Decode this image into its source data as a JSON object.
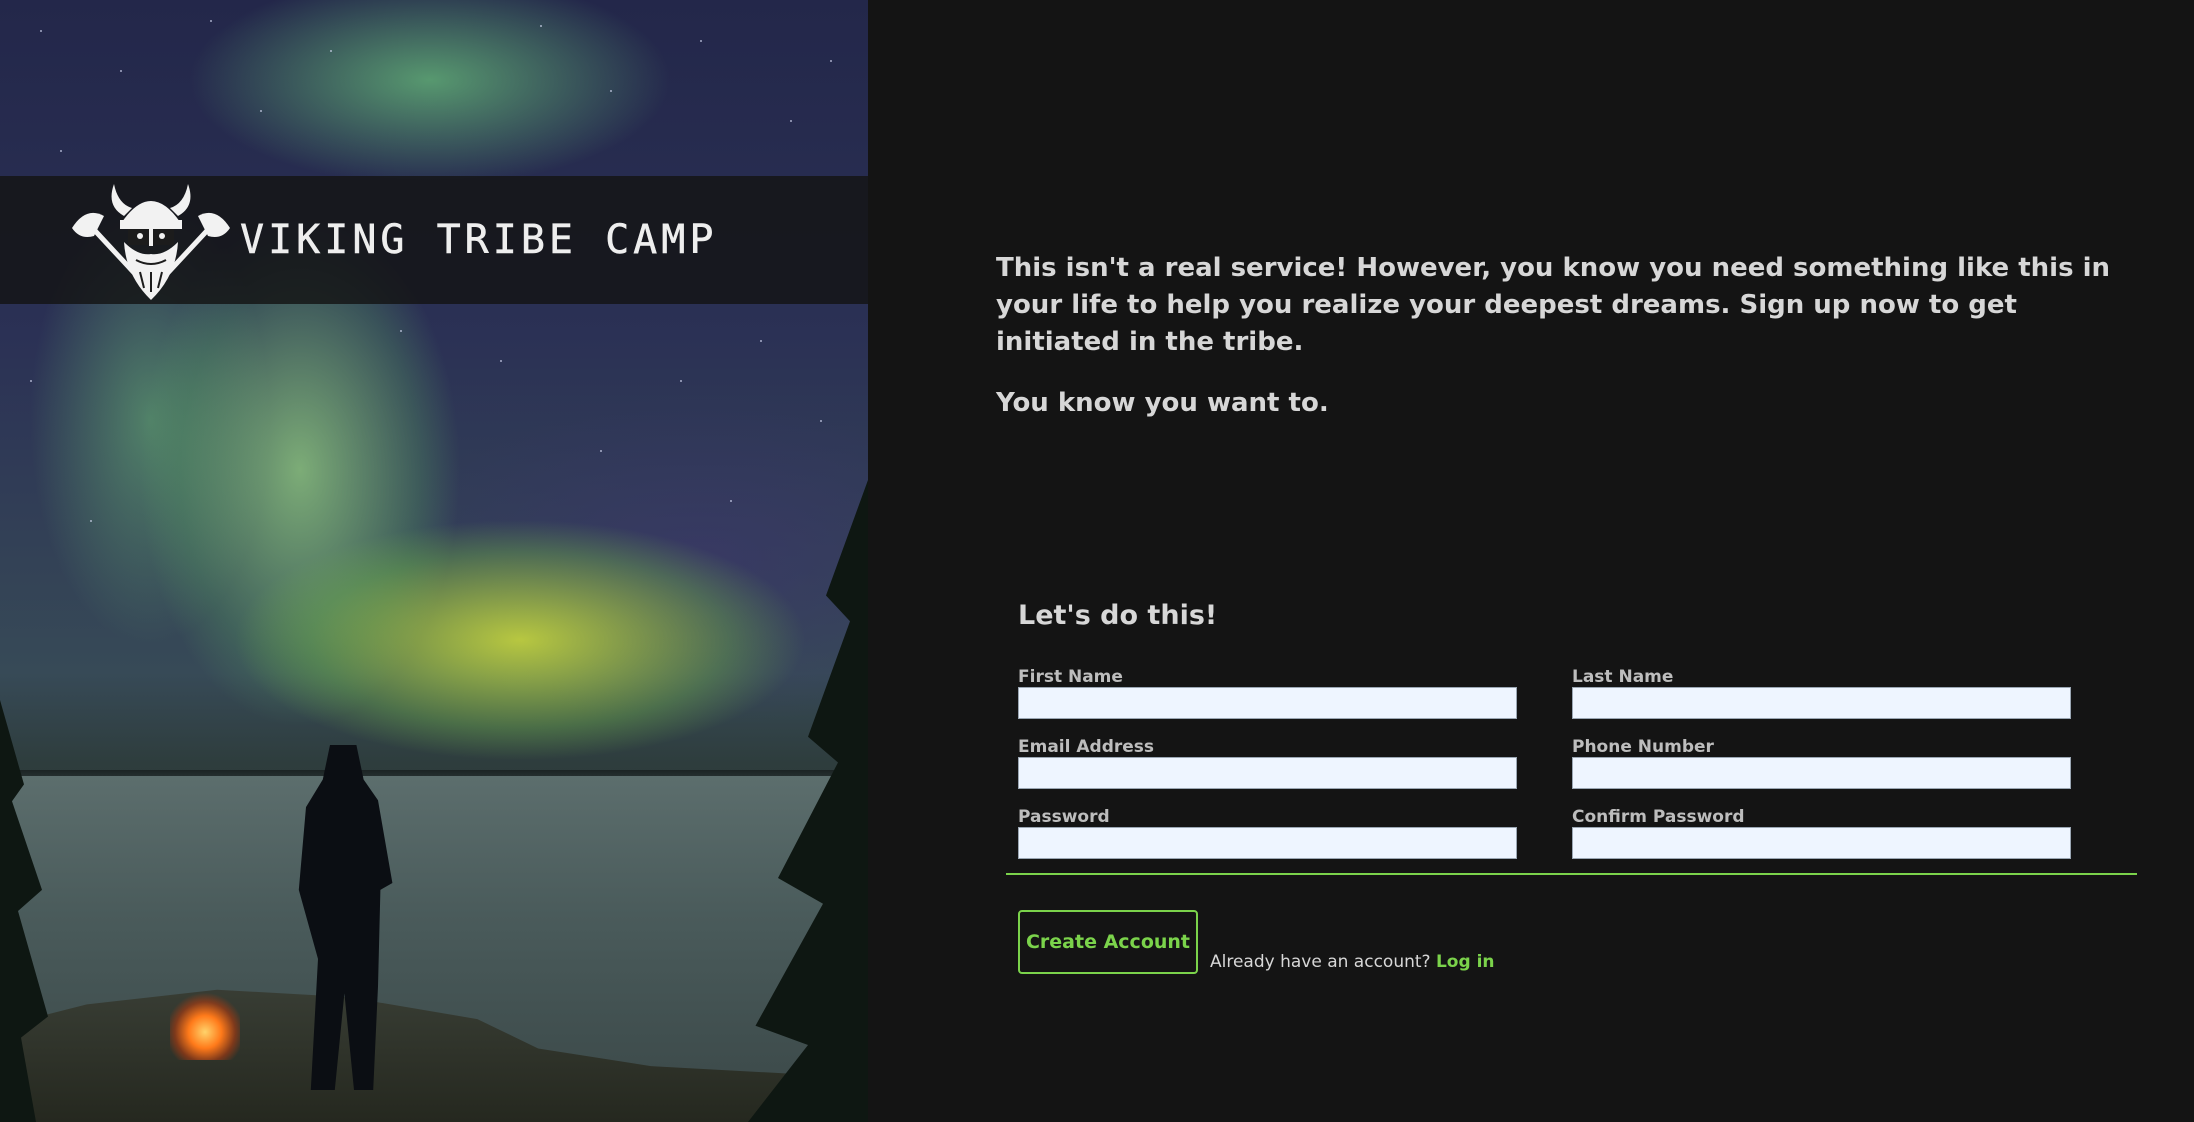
{
  "brand": {
    "name": "Viking Tribe Camp"
  },
  "intro": {
    "paragraph1": "This isn't a real service! However, you know you need something like this in your life to help you realize your deepest dreams. Sign up now to get initiated in the tribe.",
    "paragraph2": "You know you want to."
  },
  "form": {
    "title": "Let's do this!",
    "fields": {
      "first_name": {
        "label": "First Name",
        "value": "",
        "placeholder": ""
      },
      "last_name": {
        "label": "Last Name",
        "value": "",
        "placeholder": ""
      },
      "email": {
        "label": "Email Address",
        "value": "",
        "placeholder": ""
      },
      "phone": {
        "label": "Phone Number",
        "value": "",
        "placeholder": ""
      },
      "password": {
        "label": "Password",
        "value": "",
        "placeholder": ""
      },
      "confirm_password": {
        "label": "Confirm Password",
        "value": "",
        "placeholder": ""
      }
    },
    "submit_label": "Create Account",
    "login_prompt": "Already have an account?",
    "login_link": "Log in"
  },
  "colors": {
    "accent": "#7bd34b",
    "background": "#141414",
    "input_bg": "#eef5ff",
    "text": "#d7d7d7"
  },
  "icons": {
    "logo": "viking-head-with-crossed-axes"
  }
}
